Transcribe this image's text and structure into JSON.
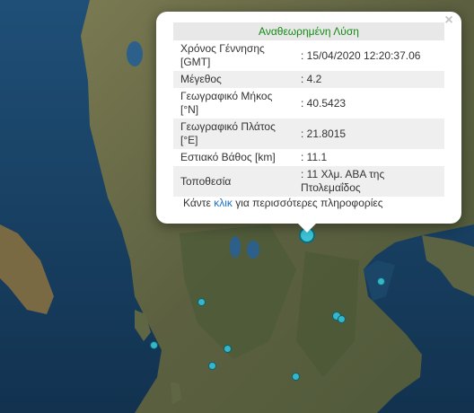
{
  "popup": {
    "title": "Αναθεωρημένη Λύση",
    "close_symbol": "×",
    "rows": [
      {
        "label": "Χρόνος Γέννησης [GMT]",
        "value": ": 15/04/2020 12:20:37.06"
      },
      {
        "label": "Μέγεθος",
        "value": ": 4.2"
      },
      {
        "label": "Γεωγραφικό Μήκος [°N]",
        "value": ": 40.5423"
      },
      {
        "label": "Γεωγραφικό Πλάτος [°E]",
        "value": ": 21.8015"
      },
      {
        "label": "Εστιακό Βάθος [km]",
        "value": ": 11.1"
      },
      {
        "label": "Τοποθεσία",
        "value": ": 11 Χλμ. ΑΒΑ της Πτολεμαΐδος"
      }
    ],
    "more_prefix": "Κάντε ",
    "more_link": "κλικ",
    "more_suffix": " για περισσότερες πληροφορίες"
  },
  "colors": {
    "sea": "#163a5c",
    "land": "#6b6a45",
    "marker": "#36b6c9",
    "title_green": "#138a13",
    "link_blue": "#1a73c8"
  },
  "markers": {
    "selected_event": "main-quake-marker",
    "other_events": 8
  }
}
